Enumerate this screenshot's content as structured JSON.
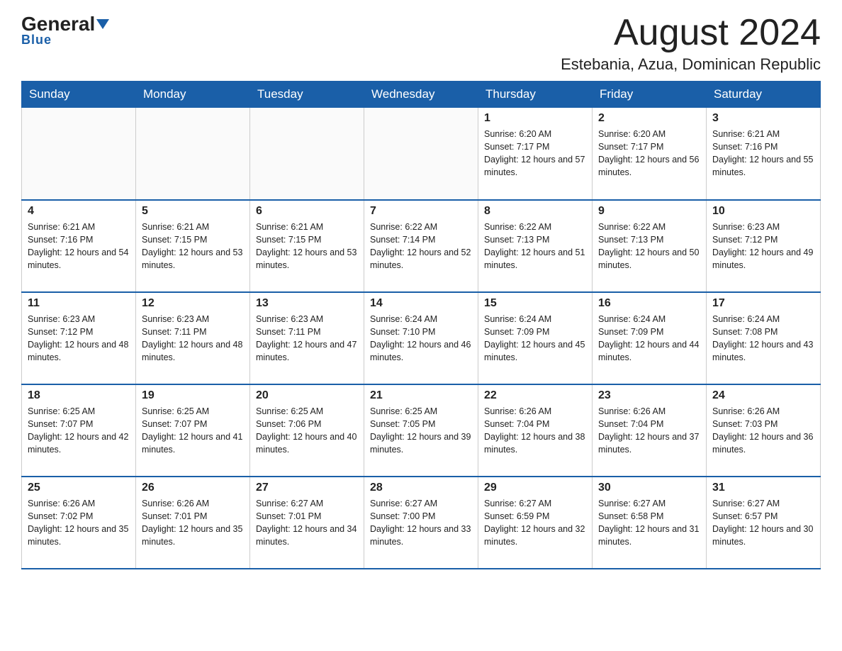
{
  "header": {
    "logo_general": "General",
    "logo_blue": "Blue",
    "title": "August 2024",
    "subtitle": "Estebania, Azua, Dominican Republic"
  },
  "calendar": {
    "days_of_week": [
      "Sunday",
      "Monday",
      "Tuesday",
      "Wednesday",
      "Thursday",
      "Friday",
      "Saturday"
    ],
    "weeks": [
      [
        {
          "day": "",
          "sunrise": "",
          "sunset": "",
          "daylight": ""
        },
        {
          "day": "",
          "sunrise": "",
          "sunset": "",
          "daylight": ""
        },
        {
          "day": "",
          "sunrise": "",
          "sunset": "",
          "daylight": ""
        },
        {
          "day": "",
          "sunrise": "",
          "sunset": "",
          "daylight": ""
        },
        {
          "day": "1",
          "sunrise": "Sunrise: 6:20 AM",
          "sunset": "Sunset: 7:17 PM",
          "daylight": "Daylight: 12 hours and 57 minutes."
        },
        {
          "day": "2",
          "sunrise": "Sunrise: 6:20 AM",
          "sunset": "Sunset: 7:17 PM",
          "daylight": "Daylight: 12 hours and 56 minutes."
        },
        {
          "day": "3",
          "sunrise": "Sunrise: 6:21 AM",
          "sunset": "Sunset: 7:16 PM",
          "daylight": "Daylight: 12 hours and 55 minutes."
        }
      ],
      [
        {
          "day": "4",
          "sunrise": "Sunrise: 6:21 AM",
          "sunset": "Sunset: 7:16 PM",
          "daylight": "Daylight: 12 hours and 54 minutes."
        },
        {
          "day": "5",
          "sunrise": "Sunrise: 6:21 AM",
          "sunset": "Sunset: 7:15 PM",
          "daylight": "Daylight: 12 hours and 53 minutes."
        },
        {
          "day": "6",
          "sunrise": "Sunrise: 6:21 AM",
          "sunset": "Sunset: 7:15 PM",
          "daylight": "Daylight: 12 hours and 53 minutes."
        },
        {
          "day": "7",
          "sunrise": "Sunrise: 6:22 AM",
          "sunset": "Sunset: 7:14 PM",
          "daylight": "Daylight: 12 hours and 52 minutes."
        },
        {
          "day": "8",
          "sunrise": "Sunrise: 6:22 AM",
          "sunset": "Sunset: 7:13 PM",
          "daylight": "Daylight: 12 hours and 51 minutes."
        },
        {
          "day": "9",
          "sunrise": "Sunrise: 6:22 AM",
          "sunset": "Sunset: 7:13 PM",
          "daylight": "Daylight: 12 hours and 50 minutes."
        },
        {
          "day": "10",
          "sunrise": "Sunrise: 6:23 AM",
          "sunset": "Sunset: 7:12 PM",
          "daylight": "Daylight: 12 hours and 49 minutes."
        }
      ],
      [
        {
          "day": "11",
          "sunrise": "Sunrise: 6:23 AM",
          "sunset": "Sunset: 7:12 PM",
          "daylight": "Daylight: 12 hours and 48 minutes."
        },
        {
          "day": "12",
          "sunrise": "Sunrise: 6:23 AM",
          "sunset": "Sunset: 7:11 PM",
          "daylight": "Daylight: 12 hours and 48 minutes."
        },
        {
          "day": "13",
          "sunrise": "Sunrise: 6:23 AM",
          "sunset": "Sunset: 7:11 PM",
          "daylight": "Daylight: 12 hours and 47 minutes."
        },
        {
          "day": "14",
          "sunrise": "Sunrise: 6:24 AM",
          "sunset": "Sunset: 7:10 PM",
          "daylight": "Daylight: 12 hours and 46 minutes."
        },
        {
          "day": "15",
          "sunrise": "Sunrise: 6:24 AM",
          "sunset": "Sunset: 7:09 PM",
          "daylight": "Daylight: 12 hours and 45 minutes."
        },
        {
          "day": "16",
          "sunrise": "Sunrise: 6:24 AM",
          "sunset": "Sunset: 7:09 PM",
          "daylight": "Daylight: 12 hours and 44 minutes."
        },
        {
          "day": "17",
          "sunrise": "Sunrise: 6:24 AM",
          "sunset": "Sunset: 7:08 PM",
          "daylight": "Daylight: 12 hours and 43 minutes."
        }
      ],
      [
        {
          "day": "18",
          "sunrise": "Sunrise: 6:25 AM",
          "sunset": "Sunset: 7:07 PM",
          "daylight": "Daylight: 12 hours and 42 minutes."
        },
        {
          "day": "19",
          "sunrise": "Sunrise: 6:25 AM",
          "sunset": "Sunset: 7:07 PM",
          "daylight": "Daylight: 12 hours and 41 minutes."
        },
        {
          "day": "20",
          "sunrise": "Sunrise: 6:25 AM",
          "sunset": "Sunset: 7:06 PM",
          "daylight": "Daylight: 12 hours and 40 minutes."
        },
        {
          "day": "21",
          "sunrise": "Sunrise: 6:25 AM",
          "sunset": "Sunset: 7:05 PM",
          "daylight": "Daylight: 12 hours and 39 minutes."
        },
        {
          "day": "22",
          "sunrise": "Sunrise: 6:26 AM",
          "sunset": "Sunset: 7:04 PM",
          "daylight": "Daylight: 12 hours and 38 minutes."
        },
        {
          "day": "23",
          "sunrise": "Sunrise: 6:26 AM",
          "sunset": "Sunset: 7:04 PM",
          "daylight": "Daylight: 12 hours and 37 minutes."
        },
        {
          "day": "24",
          "sunrise": "Sunrise: 6:26 AM",
          "sunset": "Sunset: 7:03 PM",
          "daylight": "Daylight: 12 hours and 36 minutes."
        }
      ],
      [
        {
          "day": "25",
          "sunrise": "Sunrise: 6:26 AM",
          "sunset": "Sunset: 7:02 PM",
          "daylight": "Daylight: 12 hours and 35 minutes."
        },
        {
          "day": "26",
          "sunrise": "Sunrise: 6:26 AM",
          "sunset": "Sunset: 7:01 PM",
          "daylight": "Daylight: 12 hours and 35 minutes."
        },
        {
          "day": "27",
          "sunrise": "Sunrise: 6:27 AM",
          "sunset": "Sunset: 7:01 PM",
          "daylight": "Daylight: 12 hours and 34 minutes."
        },
        {
          "day": "28",
          "sunrise": "Sunrise: 6:27 AM",
          "sunset": "Sunset: 7:00 PM",
          "daylight": "Daylight: 12 hours and 33 minutes."
        },
        {
          "day": "29",
          "sunrise": "Sunrise: 6:27 AM",
          "sunset": "Sunset: 6:59 PM",
          "daylight": "Daylight: 12 hours and 32 minutes."
        },
        {
          "day": "30",
          "sunrise": "Sunrise: 6:27 AM",
          "sunset": "Sunset: 6:58 PM",
          "daylight": "Daylight: 12 hours and 31 minutes."
        },
        {
          "day": "31",
          "sunrise": "Sunrise: 6:27 AM",
          "sunset": "Sunset: 6:57 PM",
          "daylight": "Daylight: 12 hours and 30 minutes."
        }
      ]
    ]
  }
}
